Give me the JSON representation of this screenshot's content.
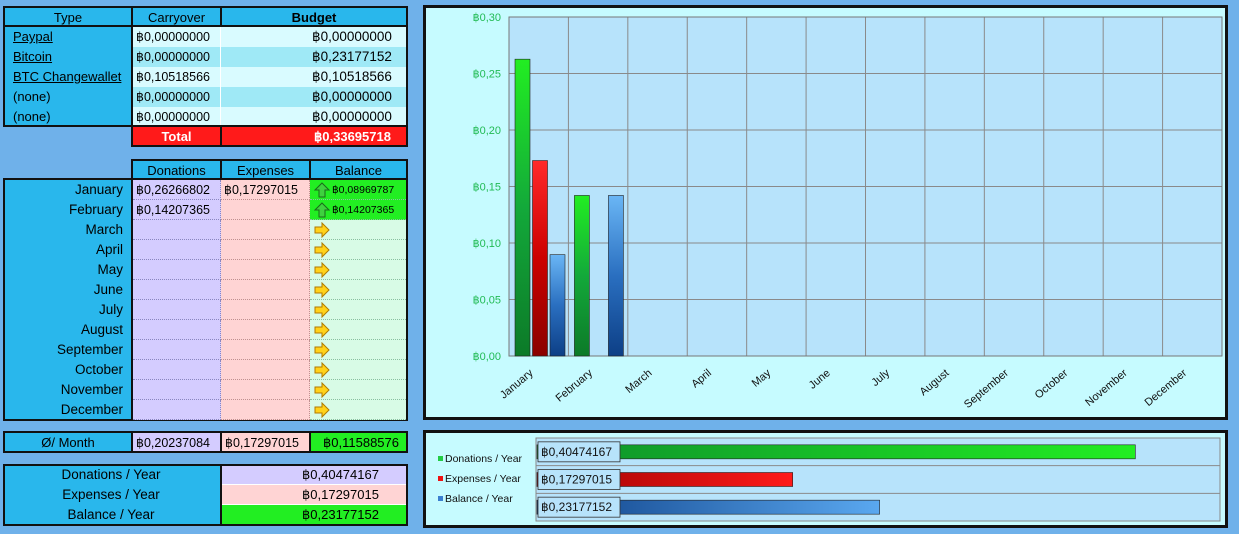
{
  "accounts": {
    "headers": {
      "type": "Type",
      "carryover": "Carryover",
      "budget": "Budget"
    },
    "rows": [
      {
        "type": "Paypal",
        "carryover": "฿0,00000000",
        "budget": "฿0,00000000",
        "link": true
      },
      {
        "type": "Bitcoin",
        "carryover": "฿0,00000000",
        "budget": "฿0,23177152",
        "link": true
      },
      {
        "type": "BTC Changewallet",
        "carryover": "฿0,10518566",
        "budget": "฿0,10518566",
        "link": true
      },
      {
        "type": "(none)",
        "carryover": "฿0,00000000",
        "budget": "฿0,00000000",
        "link": false
      },
      {
        "type": "(none)",
        "carryover": "฿0,00000000",
        "budget": "฿0,00000000",
        "link": false
      }
    ],
    "total_label": "Total",
    "total_value": "฿0,33695718"
  },
  "monthly": {
    "headers": {
      "donations": "Donations",
      "expenses": "Expenses",
      "balance": "Balance"
    },
    "rows": [
      {
        "month": "January",
        "donations": "฿0,26266802",
        "expenses": "฿0,17297015",
        "balance": "฿0,08969787",
        "trend": "up"
      },
      {
        "month": "February",
        "donations": "฿0,14207365",
        "expenses": "",
        "balance": "฿0,14207365",
        "trend": "up"
      },
      {
        "month": "March",
        "donations": "",
        "expenses": "",
        "balance": "",
        "trend": "flat"
      },
      {
        "month": "April",
        "donations": "",
        "expenses": "",
        "balance": "",
        "trend": "flat"
      },
      {
        "month": "May",
        "donations": "",
        "expenses": "",
        "balance": "",
        "trend": "flat"
      },
      {
        "month": "June",
        "donations": "",
        "expenses": "",
        "balance": "",
        "trend": "flat"
      },
      {
        "month": "July",
        "donations": "",
        "expenses": "",
        "balance": "",
        "trend": "flat"
      },
      {
        "month": "August",
        "donations": "",
        "expenses": "",
        "balance": "",
        "trend": "flat"
      },
      {
        "month": "September",
        "donations": "",
        "expenses": "",
        "balance": "",
        "trend": "flat"
      },
      {
        "month": "October",
        "donations": "",
        "expenses": "",
        "balance": "",
        "trend": "flat"
      },
      {
        "month": "November",
        "donations": "",
        "expenses": "",
        "balance": "",
        "trend": "flat"
      },
      {
        "month": "December",
        "donations": "",
        "expenses": "",
        "balance": "",
        "trend": "flat"
      }
    ],
    "average": {
      "label": "Ø/ Month",
      "donations": "฿0,20237084",
      "expenses": "฿0,17297015",
      "balance": "฿0,11588576"
    }
  },
  "yearly": [
    {
      "label": "Donations / Year",
      "value": "฿0,40474167"
    },
    {
      "label": "Expenses / Year",
      "value": "฿0,17297015"
    },
    {
      "label": "Balance / Year",
      "value": "฿0,23177152"
    }
  ],
  "colors": {
    "donations": "#22cc22",
    "expenses": "#ee1111",
    "balance": "#3a8fe0",
    "header": "#29b7ec",
    "total": "#ff1a1a"
  },
  "chart_data": [
    {
      "type": "bar",
      "categories": [
        "January",
        "February",
        "March",
        "April",
        "May",
        "June",
        "July",
        "August",
        "September",
        "October",
        "November",
        "December"
      ],
      "series": [
        {
          "name": "Donations",
          "values": [
            0.26266802,
            0.14207365,
            0,
            0,
            0,
            0,
            0,
            0,
            0,
            0,
            0,
            0
          ]
        },
        {
          "name": "Expenses",
          "values": [
            0.17297015,
            0,
            0,
            0,
            0,
            0,
            0,
            0,
            0,
            0,
            0,
            0
          ]
        },
        {
          "name": "Balance",
          "values": [
            0.08969787,
            0.14207365,
            0,
            0,
            0,
            0,
            0,
            0,
            0,
            0,
            0,
            0
          ]
        }
      ],
      "ylim": [
        0,
        0.3
      ],
      "yticks": [
        "฿0,00",
        "฿0,05",
        "฿0,10",
        "฿0,15",
        "฿0,20",
        "฿0,25",
        "฿0,30"
      ],
      "grid": true
    },
    {
      "type": "bar",
      "orientation": "horizontal",
      "categories": [
        "Donations / Year",
        "Expenses / Year",
        "Balance / Year"
      ],
      "values": [
        0.40474167,
        0.17297015,
        0.23177152
      ],
      "labels": [
        "฿0,40474167",
        "฿0,17297015",
        "฿0,23177152"
      ],
      "legend": "left"
    }
  ]
}
